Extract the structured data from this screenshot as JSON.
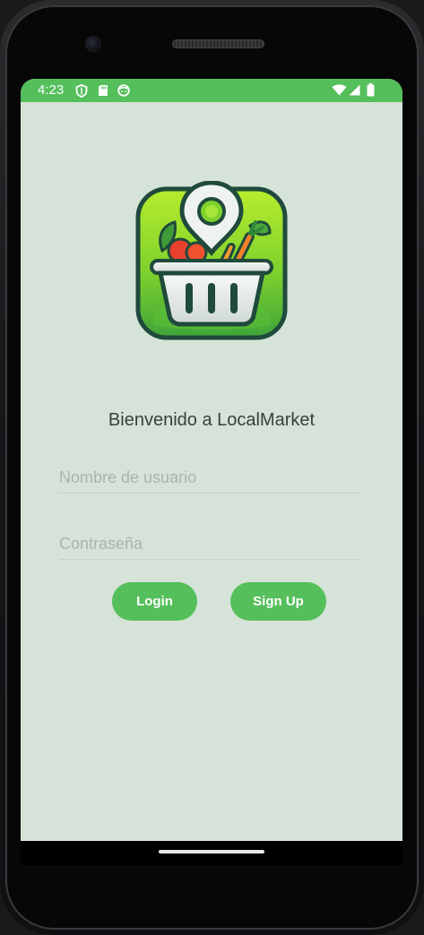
{
  "status_bar": {
    "time": "4:23",
    "left_icons": [
      "shield-icon",
      "sd-card-icon",
      "face-icon"
    ],
    "right_icons": [
      "wifi-icon",
      "cellular-signal-icon",
      "battery-icon"
    ],
    "color": "#55bf5b"
  },
  "logo": {
    "icon": "basket-location-pin-icon"
  },
  "welcome_text": "Bienvenido a LocalMarket",
  "form": {
    "username": {
      "value": "",
      "placeholder": "Nombre de usuario"
    },
    "password": {
      "value": "",
      "placeholder": "Contraseña"
    }
  },
  "buttons": {
    "login_label": "Login",
    "signup_label": "Sign Up",
    "color": "#55bf5b"
  },
  "colors": {
    "background": "#d6e3d8",
    "accent": "#55bf5b",
    "logo_dark": "#1f4a3c",
    "logo_green": "#8fdc2a"
  }
}
